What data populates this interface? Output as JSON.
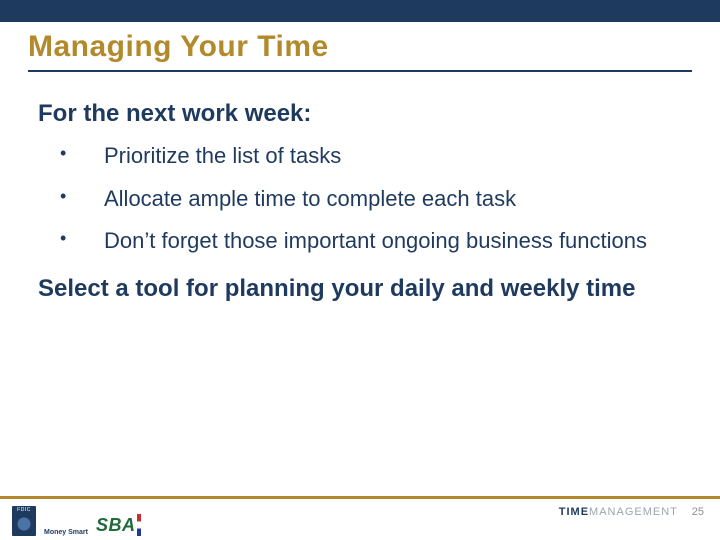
{
  "title": "Managing Your Time",
  "lead": "For the next work week:",
  "bullets": [
    "Prioritize the list of tasks",
    "Allocate ample time to complete each task",
    "Don’t forget those important ongoing business functions"
  ],
  "closing": "Select a tool for planning your daily and weekly time",
  "footer": {
    "tag_a": "TIME",
    "tag_b": "MANAGEMENT",
    "page": "25",
    "fdic": "FDIC",
    "moneysmart": "Money\nSmart",
    "sba": "SBA"
  }
}
